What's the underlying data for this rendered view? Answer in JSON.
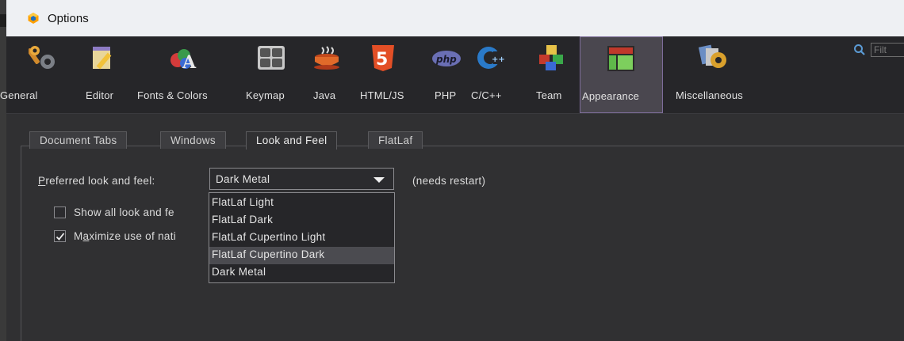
{
  "window": {
    "title": "Options",
    "logo_icon": "options-cube-icon",
    "accent": "#ffa000"
  },
  "toolbar": {
    "categories": [
      {
        "label": "General",
        "icon": "wrench-gear-icon"
      },
      {
        "label": "Editor",
        "icon": "notepad-pencil-icon"
      },
      {
        "label": "Fonts & Colors",
        "icon": "fonts-colors-icon"
      },
      {
        "label": "Keymap",
        "icon": "keyboard-keys-icon"
      },
      {
        "label": "Java",
        "icon": "coffee-cup-icon"
      },
      {
        "label": "HTML/JS",
        "icon": "html5-icon"
      },
      {
        "label": "PHP",
        "icon": "php-icon",
        "icon_text": "php"
      },
      {
        "label": "C/C++",
        "icon": "cpp-icon"
      },
      {
        "label": "Team",
        "icon": "team-blocks-icon"
      },
      {
        "label": "Appearance",
        "icon": "appearance-layout-icon",
        "selected": true
      },
      {
        "label": "Miscellaneous",
        "icon": "miscellaneous-icon"
      }
    ],
    "filter_placeholder": "Filt"
  },
  "tabs": [
    {
      "label": "Document Tabs"
    },
    {
      "label": "Windows"
    },
    {
      "label": "Look and Feel",
      "active": true
    },
    {
      "label": "FlatLaf"
    }
  ],
  "look_and_feel": {
    "label_mnemonic": "P",
    "label_rest": "referred look and feel:",
    "selected": "Dark Metal",
    "restart_note": "(needs restart)",
    "options": [
      "FlatLaf Light",
      "FlatLaf Dark",
      "FlatLaf Cupertino Light",
      "FlatLaf Cupertino Dark",
      "Dark Metal"
    ],
    "highlighted_option": "FlatLaf Cupertino Dark",
    "show_all_label": "Show all look and fe",
    "show_all_checked": false,
    "maximize_pre": "M",
    "maximize_mnemonic": "a",
    "maximize_post": "ximize use of nati",
    "maximize_checked": true
  }
}
